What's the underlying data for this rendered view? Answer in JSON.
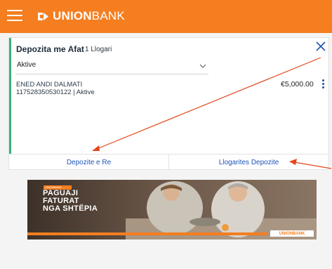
{
  "header": {
    "menu_icon": "hamburger-icon",
    "brand_strong": "UNION",
    "brand_light": "BANK",
    "color": "#f47e20"
  },
  "card": {
    "title": "Depozita me Afat",
    "count": "1 Llogari",
    "close_icon": "close-icon",
    "filter_value": "Aktive",
    "accent_color": "#36b37e",
    "account": {
      "name": "ENED ANDI DALMATI",
      "number_status": "117528350530122 | Aktive",
      "amount": "€5,000.00",
      "menu_icon": "kebab-menu-icon"
    },
    "actions": {
      "new_deposit": "Depozite e Re",
      "deposit_accounts": "Llogarites Depozite"
    }
  },
  "banner": {
    "tag": "UNIONBANK",
    "line1": "PAGUAJI",
    "line2": "FATURAT",
    "line3": "NGA SHTËPIA",
    "logo": "UNIONBANK"
  },
  "annotations": {
    "arrow_color": "#e2461a"
  }
}
